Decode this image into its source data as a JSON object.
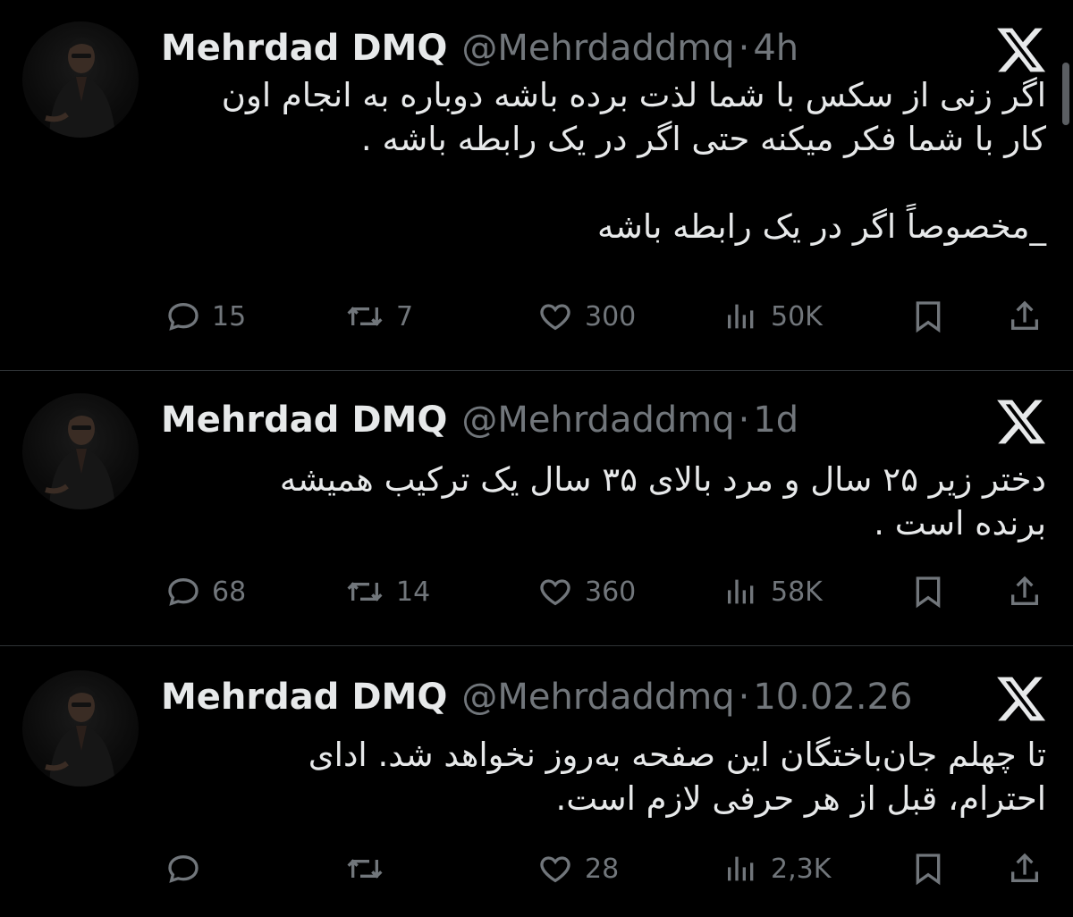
{
  "tweets": [
    {
      "name": "Mehrdad DMQ",
      "handle": "@Mehrdaddmq",
      "time": "4h",
      "text_lines": [
        "اگر زنی از سکس با شما لذت برده باشه دوباره به انجام اون",
        "کار با شما فکر میکنه حتی اگر در یک رابطه باشه .",
        "",
        "_مخصوصاً اگر در یک رابطه باشه"
      ],
      "replies": "15",
      "reposts": "7",
      "likes": "300",
      "views": "50K"
    },
    {
      "name": "Mehrdad DMQ",
      "handle": "@Mehrdaddmq",
      "time": "1d",
      "text_lines": [
        "دختر زیر ۲۵ سال و مرد بالای ۳۵ سال یک ترکیب همیشه",
        "برنده است ."
      ],
      "replies": "68",
      "reposts": "14",
      "likes": "360",
      "views": "58K"
    },
    {
      "name": "Mehrdad DMQ",
      "handle": "@Mehrdaddmq",
      "time": "10.02.26",
      "text_lines": [
        "تا چهلم جان‌باختگان این صفحه به‌روز نخواهد شد. ادای",
        "احترام، قبل از هر حرفی لازم است."
      ],
      "replies": "",
      "reposts": "",
      "likes": "28",
      "views": "2,3K"
    }
  ],
  "separator": "·",
  "icons": {
    "brand": "x-logo-icon",
    "reply": "reply-bubble-icon",
    "repost": "repost-icon",
    "like": "heart-icon",
    "views": "views-bars-icon",
    "bookmark": "bookmark-icon",
    "share": "share-icon"
  },
  "colors": {
    "background": "#000000",
    "text": "#e7e9ea",
    "secondary": "#71767b",
    "divider": "#2f3336"
  }
}
